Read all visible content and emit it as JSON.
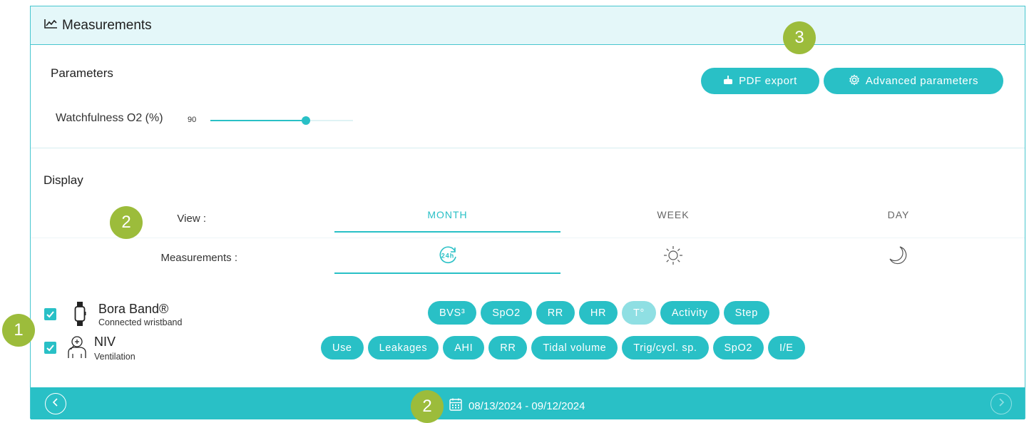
{
  "header": {
    "title": "Measurements",
    "icon": "line-chart-icon"
  },
  "parameters": {
    "title": "Parameters",
    "pdf_export": "PDF export",
    "advanced_parameters": "Advanced parameters",
    "slider": {
      "label": "Watchfulness O2 (%)",
      "value": "90",
      "fill_fraction": 0.67
    }
  },
  "display": {
    "title": "Display",
    "view_label": "View :",
    "views": [
      "MONTH",
      "WEEK",
      "DAY"
    ],
    "active_view": "MONTH",
    "measurements_label": "Measurements :",
    "measurement_icons": [
      "24h-cycle-icon",
      "sun-icon",
      "moon-icon"
    ]
  },
  "devices": [
    {
      "name": "Bora Band®",
      "subtitle": "Connected wristband",
      "checked": true,
      "chips": [
        "BVS³",
        "SpO2",
        "RR",
        "HR",
        "T°",
        "Activity",
        "Step"
      ],
      "disabled_chips": [
        "T°"
      ]
    },
    {
      "name": "NIV",
      "subtitle": "Ventilation",
      "checked": true,
      "chips": [
        "Use",
        "Leakages",
        "AHI",
        "RR",
        "Tidal volume",
        "Trig/cycl. sp.",
        "SpO2",
        "I/E"
      ]
    }
  ],
  "footer": {
    "date_range": "08/13/2024 - 09/12/2024"
  },
  "badges": {
    "b1": "1",
    "b2": "2",
    "b3": "3"
  },
  "colors": {
    "accent": "#29c0c6",
    "badge": "#9cbc3b",
    "header_bg": "#e4f7f9"
  }
}
